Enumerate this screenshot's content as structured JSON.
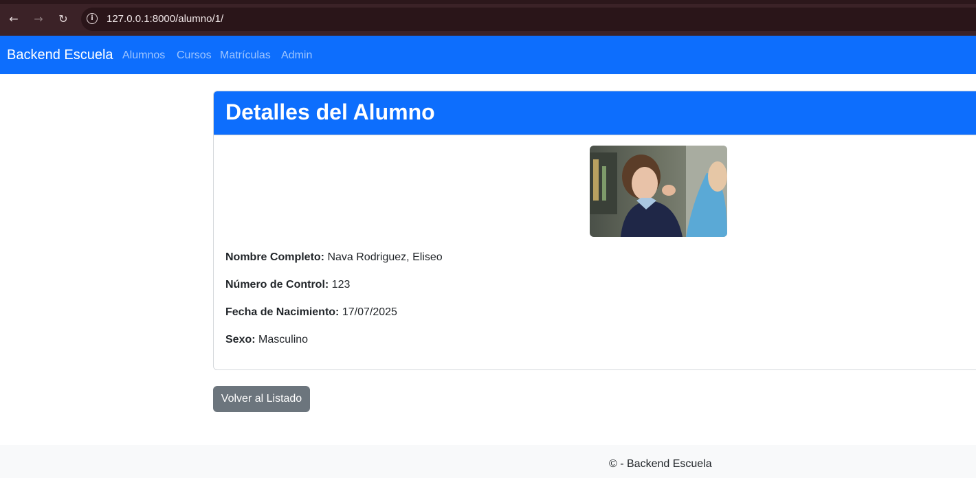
{
  "browser": {
    "url": "127.0.0.1:8000/alumno/1/",
    "back_icon": "←",
    "forward_icon": "→",
    "reload_icon": "↻",
    "info_icon": "i"
  },
  "navbar": {
    "brand": "Backend Escuela",
    "links": [
      "Alumnos",
      "Cursos",
      "Matrículas",
      "Admin"
    ],
    "color": "#0d6efd"
  },
  "card": {
    "title": "Detalles del Alumno",
    "photo_icon": "student-photo",
    "fields": [
      {
        "label": "Nombre Completo:",
        "value": "Nava Rodriguez, Eliseo"
      },
      {
        "label": "Número de Control:",
        "value": "123"
      },
      {
        "label": "Fecha de Nacimiento:",
        "value": "17/07/2025"
      },
      {
        "label": "Sexo:",
        "value": "Masculino"
      }
    ]
  },
  "actions": {
    "back_label": "Volver al Listado"
  },
  "footer": {
    "text": "© - Backend Escuela"
  }
}
